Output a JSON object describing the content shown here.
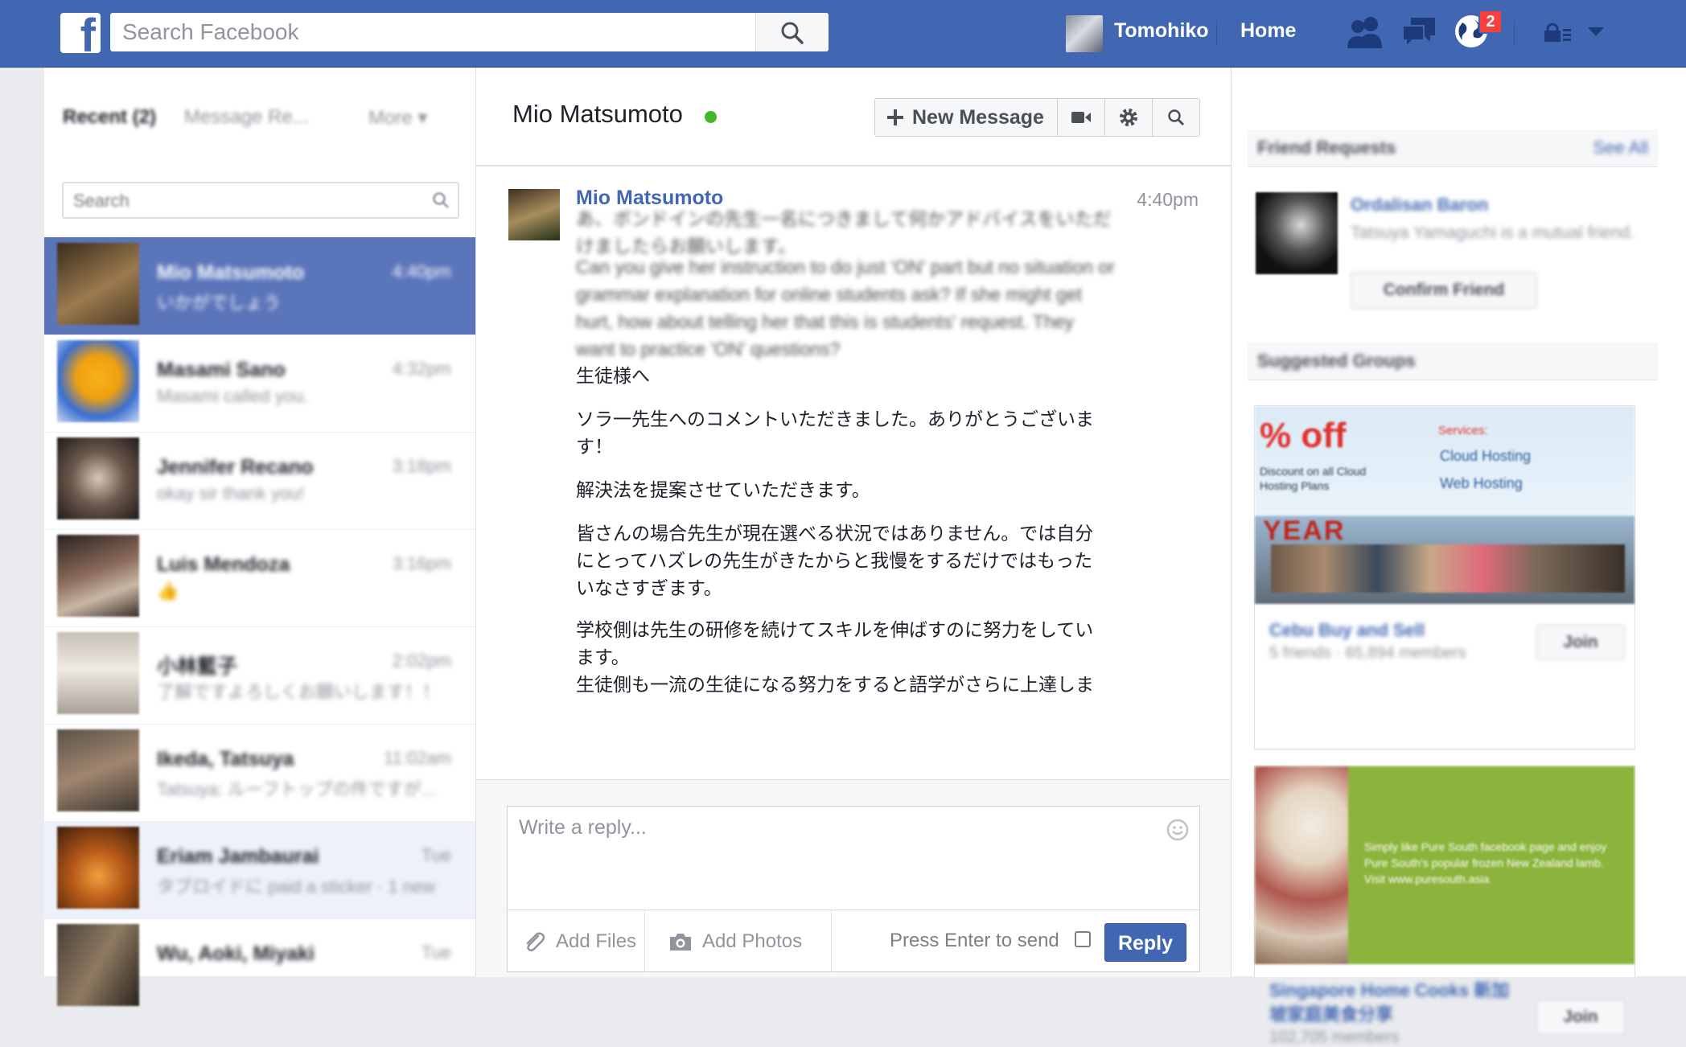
{
  "topbar": {
    "logo": "f",
    "search_placeholder": "Search Facebook",
    "profile_name": "Tomohiko",
    "home_label": "Home",
    "notification_count": "2",
    "colors": {
      "bar": "#4267b2",
      "badge": "#fa3e3e"
    }
  },
  "left": {
    "tabs": {
      "recent": "Recent (2)",
      "requests": "Message Re...",
      "more": "More ▾"
    },
    "search_placeholder": "Search",
    "conversations": [
      {
        "name": "Mio Matsumoto",
        "preview": "いかがでしょう",
        "time": "4:40pm"
      },
      {
        "name": "Masami Sano",
        "preview": "Masami called you.",
        "time": "4:32pm"
      },
      {
        "name": "Jennifer Recano",
        "preview": "okay sir thank you!",
        "time": "3:18pm"
      },
      {
        "name": "Luis Mendoza",
        "preview": "👍",
        "time": "3:16pm"
      },
      {
        "name": "小林藍子",
        "preview": "了解ですよろしくお願いします！！",
        "time": "2:02pm"
      },
      {
        "name": "Ikeda, Tatsuya",
        "preview": "Tatsuya: ルーフトップの件ですが...",
        "time": "11:02am"
      },
      {
        "name": "Eriam Jambaurai",
        "preview": "タブロイドに paid a sticker · 1 new",
        "time": "Tue"
      },
      {
        "name": "Wu, Aoki, Miyaki",
        "preview": "",
        "time": "Tue"
      }
    ]
  },
  "chat": {
    "title": "Mio Matsumoto",
    "header_buttons": {
      "new_message": "New Message"
    },
    "message": {
      "sender": "Mio Matsumoto",
      "time": "4:40pm",
      "blurred_intro": "あ、ボンドインの先生一名につきまして何かアドバイスをいただけましたらお願いします。",
      "blurred_english": "Can you give her instruction to do just 'ON' part but no situation or grammar explanation for online students ask? If she might get hurt, how about telling her that this is students' request. They want to practice 'ON' questions?",
      "jp_greeting": "生徒様へ",
      "jp_comment_line": "ソラ一先生へのコメントいただきました。ありがとうございます！",
      "jp_solution": "解決法を提案させていただきます。",
      "jp_para1": "皆さんの場合先生が現在選べる状況ではありません。では自分にとってハズレの先生がきたからと我慢をするだけではもったいなさすぎます。",
      "jp_para2": "学校側は先生の研修を続けてスキルを伸ばすのに努力をしています。",
      "jp_para3": "生徒側も一流の生徒になる努力をすると語学がさらに上達しま"
    },
    "reply": {
      "placeholder": "Write a reply...",
      "add_files": "Add Files",
      "add_photos": "Add Photos",
      "enter_label": "Press Enter to send",
      "reply_button": "Reply"
    }
  },
  "right": {
    "friend_requests_title": "Friend Requests",
    "see_all": "See All",
    "request": {
      "name": "Ordalisan Baron",
      "mutual": "Tatsuya Yamaguchi is a mutual friend.",
      "confirm": "Confirm Friend"
    },
    "suggested_title": "Suggested Groups",
    "groups": [
      {
        "name": "Cebu Buy and Sell",
        "meta": "5 friends · 65,894 members",
        "join": "Join",
        "ad_text": "% off",
        "ad_sub": "Discount on all Cloud Hosting Plans",
        "ad_services": [
          "Services:",
          "Cloud Hosting",
          "Web Hosting"
        ],
        "ad_year": "YEAR"
      },
      {
        "name": "Singapore Home Cooks 新加坡家庭美食分享",
        "meta": "102,705 members",
        "join": "Join",
        "ad_text": "Simply like Pure South facebook page and enjoy Pure South's popular frozen New Zealand lamb. Visit www.puresouth.asia"
      }
    ]
  }
}
